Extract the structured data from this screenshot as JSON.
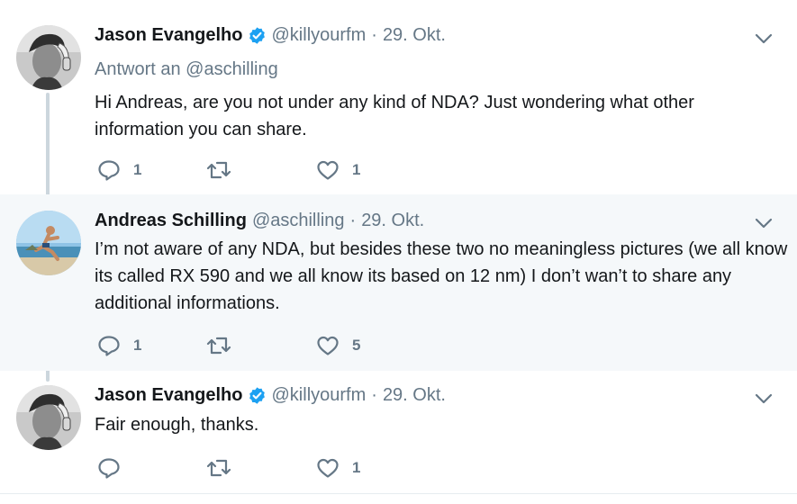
{
  "colors": {
    "verified": "#1da1f2",
    "secondary_text": "#657786",
    "highlight_bg": "#f5f8fa",
    "thread_line": "#ccd6dd"
  },
  "tweets": [
    {
      "author_name": "Jason Evangelho",
      "verified": true,
      "handle": "@killyourfm",
      "separator": "·",
      "date": "29. Okt.",
      "reply_to_prefix": "Antwort an",
      "reply_to_handle": "@aschilling",
      "text": "Hi Andreas, are you not under any kind of NDA? Just wondering what other information you can share.",
      "reply_count": "1",
      "retweet_count": "",
      "like_count": "1",
      "icons": {
        "avatar": "person-with-headphones-avatar",
        "menu": "chevron-down-icon"
      }
    },
    {
      "author_name": "Andreas Schilling",
      "verified": false,
      "handle": "@aschilling",
      "separator": "·",
      "date": "29. Okt.",
      "text": "I’m not aware of any NDA, but besides these two no meaningless pictures (we all know its called RX 590 and we all know its based on 12 nm) I don’t wan’t to share any additional informations.",
      "reply_count": "1",
      "retweet_count": "",
      "like_count": "5",
      "icons": {
        "avatar": "person-jumping-beach-avatar",
        "menu": "chevron-down-icon"
      }
    },
    {
      "author_name": "Jason Evangelho",
      "verified": true,
      "handle": "@killyourfm",
      "separator": "·",
      "date": "29. Okt.",
      "text": "Fair enough, thanks.",
      "reply_count": "",
      "retweet_count": "",
      "like_count": "1",
      "icons": {
        "avatar": "person-with-headphones-avatar",
        "menu": "chevron-down-icon"
      }
    }
  ]
}
